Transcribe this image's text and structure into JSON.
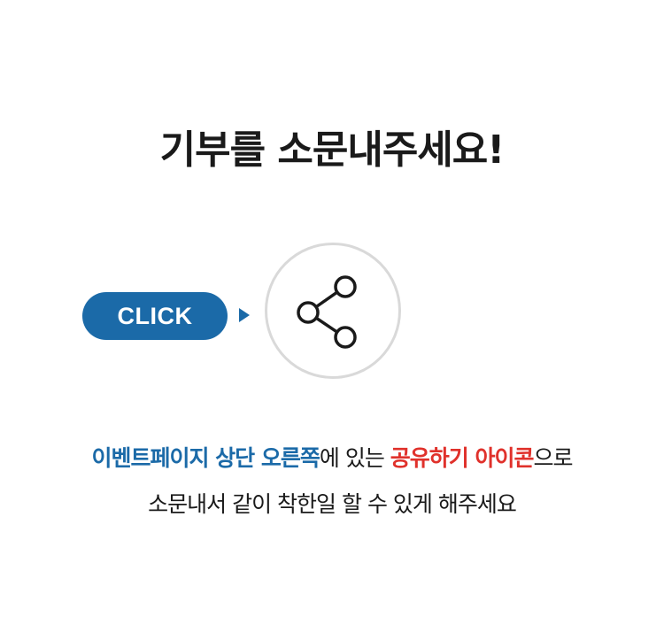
{
  "title": "기부를 소문내주세요!",
  "click_label": "CLICK",
  "icons": {
    "arrow": "triangle-right",
    "share": "share-icon"
  },
  "colors": {
    "accent_blue": "#1b6aa8",
    "accent_red": "#e0312b",
    "text": "#1a1a1a",
    "circle_border": "#d9d9d9"
  },
  "description": {
    "line1_blue": "이벤트페이지 상단 오른쪽",
    "line1_mid": "에 있는 ",
    "line1_red": "공유하기 아이콘",
    "line1_end": "으로",
    "line2": "소문내서 같이 착한일 할 수 있게 해주세요"
  }
}
